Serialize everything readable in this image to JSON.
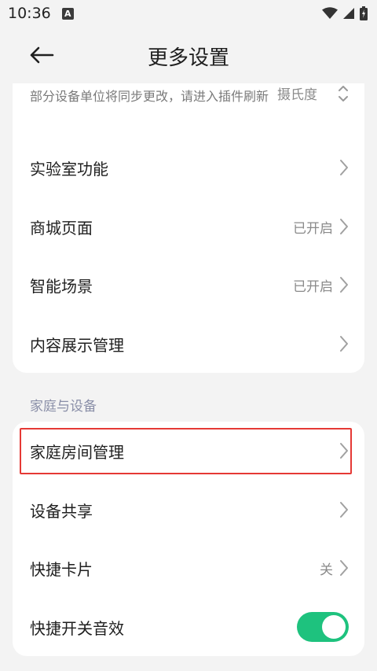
{
  "status_bar": {
    "time": "10:36",
    "badge": "A"
  },
  "header": {
    "title": "更多设置"
  },
  "unit_setting": {
    "note": "部分设备单位将同步更改，请进入插件刷新",
    "value": "摄氏度"
  },
  "general_items": [
    {
      "label": "实验室功能",
      "value": ""
    },
    {
      "label": "商城页面",
      "value": "已开启"
    },
    {
      "label": "智能场景",
      "value": "已开启"
    },
    {
      "label": "内容展示管理",
      "value": ""
    }
  ],
  "home_section": {
    "title": "家庭与设备",
    "items": [
      {
        "label": "家庭房间管理",
        "value": ""
      },
      {
        "label": "设备共享",
        "value": ""
      },
      {
        "label": "快捷卡片",
        "value": "关"
      },
      {
        "label": "快捷开关音效",
        "toggle_on": true
      }
    ]
  },
  "colors": {
    "toggle_on": "#1ec27e",
    "highlight": "#e53935"
  }
}
